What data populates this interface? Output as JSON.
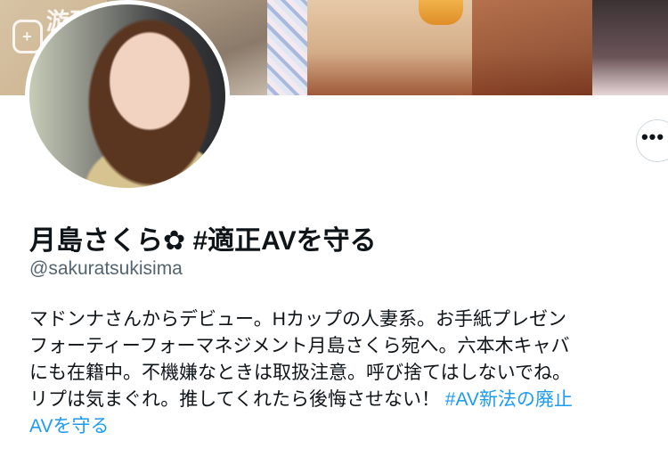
{
  "banner": {
    "watermark_text": "游研社",
    "watermark_icon": "+"
  },
  "profile": {
    "display_name": "月島さくら✿ #適正AVを守る",
    "handle": "@sakuratsukisima",
    "more_icon": "•••"
  },
  "bio": {
    "lines": [
      {
        "text": "マドンナさんからデビュー。Hカップの人妻系。お手紙プレゼン"
      },
      {
        "text": "フォーティーフォーマネジメント月島さくら宛へ。六本木キャバ"
      },
      {
        "text": "にも在籍中。不機嫌なときは取扱注意。呼び捨てはしないでね。"
      },
      {
        "text": "リプは気まぐれ。推してくれたら後悔させない！",
        "hashtag": "#AV新法の廃止"
      },
      {
        "hashtag": "AVを守る"
      }
    ]
  },
  "colors": {
    "text": "#0f1419",
    "secondary": "#536471",
    "link": "#1d9bf0",
    "border": "#cfd9de"
  }
}
